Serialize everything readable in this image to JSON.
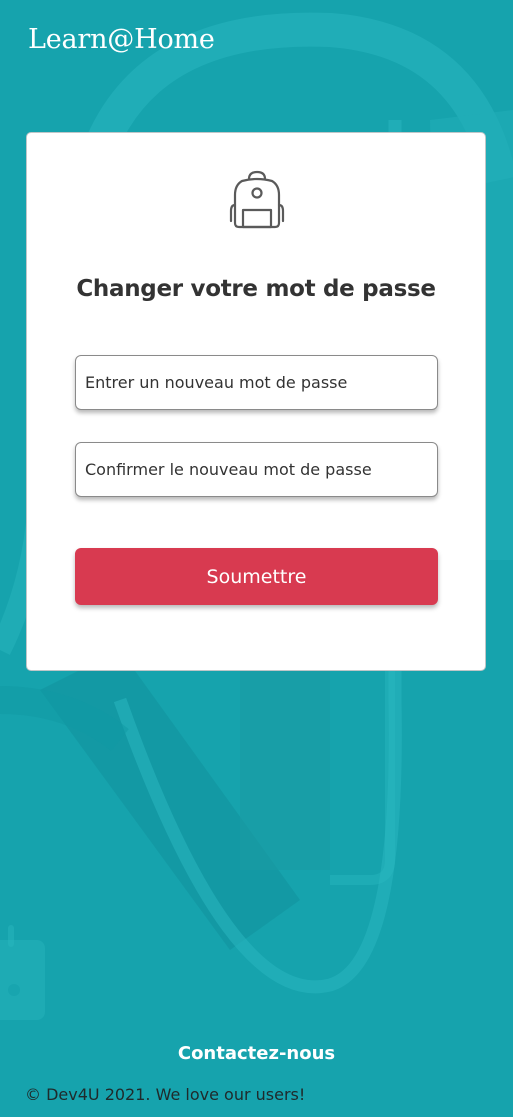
{
  "header": {
    "logo_text": "Learn@Home"
  },
  "card": {
    "icon": "backpack-icon",
    "title": "Changer votre mot de passe",
    "new_password": {
      "placeholder": "Entrer un nouveau mot de passe",
      "value": ""
    },
    "confirm_password": {
      "placeholder": "Confirmer le nouveau mot de passe",
      "value": ""
    },
    "submit_label": "Soumettre"
  },
  "footer": {
    "contact_label": "Contactez-nous",
    "copyright": "© Dev4U 2021. We love our users!"
  },
  "colors": {
    "background": "#16a3ad",
    "submit_button": "#d83a50",
    "card": "#ffffff"
  }
}
